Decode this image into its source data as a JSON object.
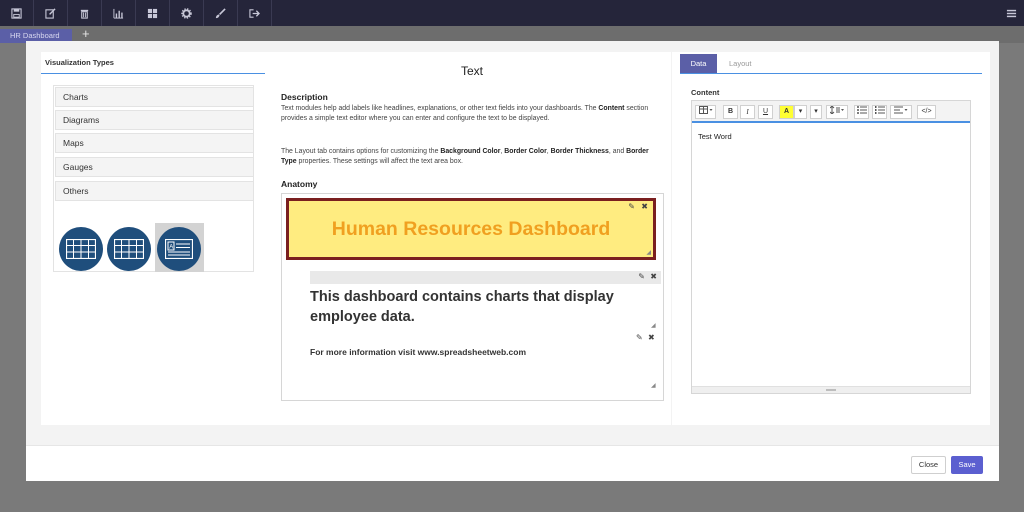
{
  "toolbar": {
    "icons": [
      "save-icon",
      "edit-icon",
      "delete-icon",
      "chart-icon",
      "grid-icon",
      "gear-icon",
      "brush-icon",
      "export-icon",
      "menu-icon"
    ]
  },
  "tabs": {
    "active_label": "HR Dashboard",
    "add_label": "+"
  },
  "left": {
    "title": "Visualization Types",
    "items": [
      "Charts",
      "Diagrams",
      "Maps",
      "Gauges",
      "Others"
    ]
  },
  "middle": {
    "title": "Text",
    "description_heading": "Description",
    "desc1_a": "Text modules help add labels like headlines, explanations, or other text fields into your dashboards. The ",
    "desc1_b": "Content",
    "desc1_c": " section provides a simple text editor where you can enter and configure the text to be displayed.",
    "desc2_a": "The Layout tab contains options for customizing the ",
    "desc2_b1": "Background Color",
    "desc2_s1": ", ",
    "desc2_b2": "Border Color",
    "desc2_s2": ", ",
    "desc2_b3": "Border Thickness",
    "desc2_s3": ", and ",
    "desc2_b4": "Border Type",
    "desc2_c": " properties. These settings will affect the text area box.",
    "anatomy_heading": "Anatomy",
    "anatomy": {
      "headline": "Human Resources Dashboard",
      "line1": "This dashboard contains charts that display",
      "line2": "employee data.",
      "small": "For more information visit  www.spreadsheetweb.com"
    }
  },
  "right": {
    "tab_data": "Data",
    "tab_layout": "Layout",
    "content_label": "Content",
    "editor_text": "Test Word",
    "editor_buttons": {
      "bold": "B",
      "italic": "I",
      "underline": "U",
      "highlight": "A",
      "code": "</>"
    }
  },
  "footer": {
    "close": "Close",
    "save": "Save"
  },
  "colors": {
    "accent": "#5b5fa7",
    "save_button": "#5b5fd0",
    "headline_text": "#f0a020",
    "headline_bg": "#ffec80",
    "headline_border": "#7a1f1f",
    "viz_icon": "#1f4e7c"
  }
}
